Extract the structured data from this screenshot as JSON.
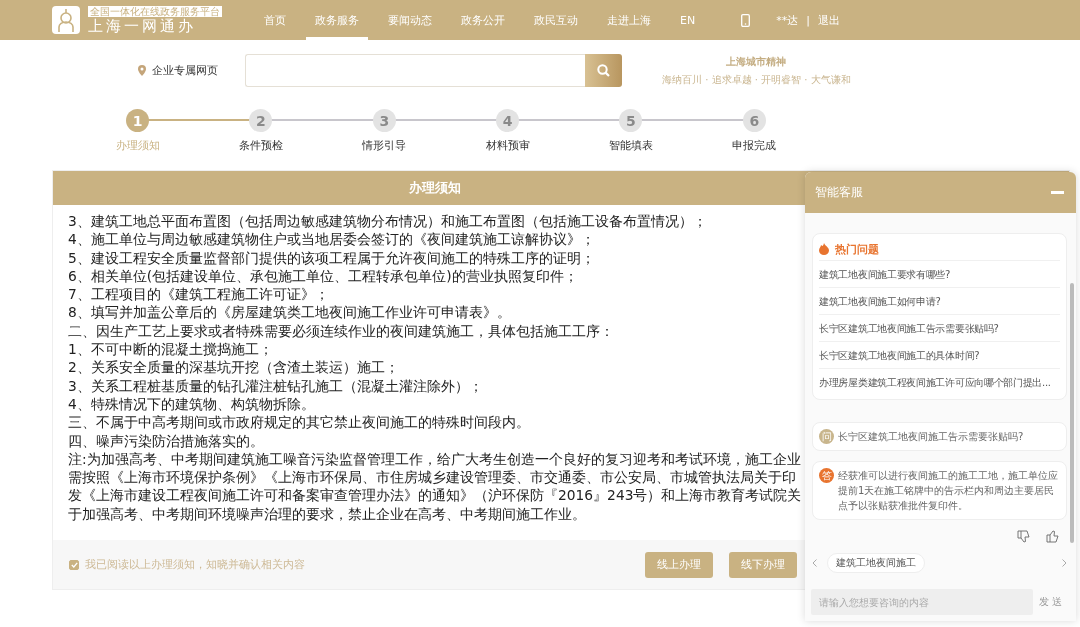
{
  "header": {
    "logo_tagline": "全国一体化在线政务服务平台",
    "logo_title": "上海一网通办",
    "nav": [
      {
        "label": "首页",
        "selected": false
      },
      {
        "label": "政务服务",
        "selected": true
      },
      {
        "label": "要闻动态",
        "selected": false
      },
      {
        "label": "政务公开",
        "selected": false
      },
      {
        "label": "政民互动",
        "selected": false
      },
      {
        "label": "走进上海",
        "selected": false
      },
      {
        "label": "EN",
        "selected": false
      }
    ],
    "user": "**达",
    "separator": "|",
    "logout": "退出"
  },
  "search_bar": {
    "location": "企业专属网页",
    "slogan_title": "上海城市精神",
    "slogan_text": "海纳百川 · 追求卓越 · 开明睿智 · 大气谦和"
  },
  "steps": [
    {
      "number": "1",
      "label": "办理须知",
      "selected": true
    },
    {
      "number": "2",
      "label": "条件预检",
      "selected": false
    },
    {
      "number": "3",
      "label": "情形引导",
      "selected": false
    },
    {
      "number": "4",
      "label": "材料预审",
      "selected": false
    },
    {
      "number": "5",
      "label": "智能填表",
      "selected": false
    },
    {
      "number": "6",
      "label": "申报完成",
      "selected": false
    }
  ],
  "notice": {
    "title": "办理须知",
    "lines": [
      "3、建筑工地总平面布置图（包括周边敏感建筑物分布情况）和施工布置图（包括施工设备布置情况）；",
      "4、施工单位与周边敏感建筑物住户或当地居委会签订的《夜间建筑施工谅解协议》；",
      "5、建设工程安全质量监督部门提供的该项工程属于允许夜间施工的特殊工序的证明；",
      "6、相关单位(包括建设单位、承包施工单位、工程转承包单位)的营业执照复印件；",
      "7、工程项目的《建筑工程施工许可证》；",
      "8、填写并加盖公章后的《房屋建筑类工地夜间施工作业许可申请表》。",
      "二、因生产工艺上要求或者特殊需要必须连续作业的夜间建筑施工，具体包括施工工序：",
      "1、不可中断的混凝土搅捣施工；",
      "2、关系安全质量的深基坑开挖（含渣土装运）施工；",
      "3、关系工程桩基质量的钻孔灌注桩钻孔施工（混凝土灌注除外）；",
      "4、特殊情况下的建筑物、构筑物拆除。",
      "三、不属于中高考期间或市政府规定的其它禁止夜间施工的特殊时间段内。",
      "四、噪声污染防治措施落实的。",
      "注:为加强高考、中考期间建筑施工噪音污染监督管理工作，给广大考生创造一个良好的复习迎考和考试环境，施工企业需按照《上海市环境保护条例》《上海市环保局、市住房城乡建设管理委、市交通委、市公安局、市城管执法局关于印发《上海市建设工程夜间施工许可和备案审查管理办法》的通知》（沪环保防『2016』243号）和上海市教育考试院关于加强高考、中考期间环境噪声治理的要求，禁止企业在高考、中考期间施工作业。"
    ],
    "agree": {
      "label": "我已阅读以上办理须知，知晓并确认相关内容",
      "checked": true
    },
    "buttons": [
      "线上办理",
      "线下办理"
    ]
  },
  "chat": {
    "title": "智能客服",
    "hot_title": "热门问题",
    "hot_questions": [
      "建筑工地夜间施工要求有哪些?",
      "建筑工地夜间施工如何申请?",
      "长宁区建筑工地夜间施工告示需要张贴吗?",
      "长宁区建筑工地夜间施工的具体时间?",
      "办理房屋类建筑工程夜间施工许可应向哪个部门提出..."
    ],
    "messages": [
      {
        "kind": "question",
        "badge": "问",
        "text": "长宁区建筑工地夜间施工告示需要张贴吗?"
      },
      {
        "kind": "answer",
        "badge": "答",
        "text": "经获准可以进行夜间施工的施工工地，施工单位应提前1天在施工铭牌中的告示栏内和周边主要居民点予以张贴获准批件复印件。"
      }
    ],
    "chips": [
      "建筑工地夜间施工"
    ],
    "input_placeholder": "请输入您想要咨询的内容",
    "send": "发送"
  }
}
